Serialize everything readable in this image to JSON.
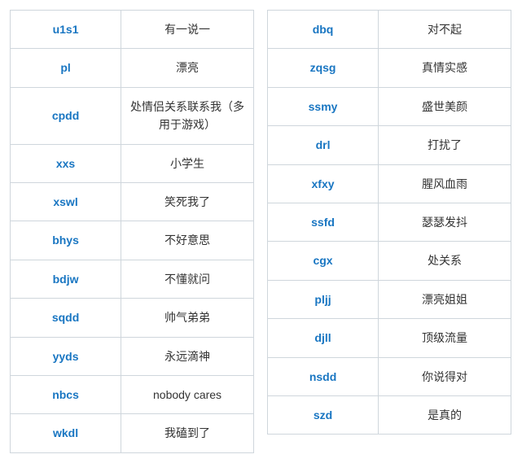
{
  "left": [
    {
      "abbr": "u1s1",
      "meaning": "有一说一"
    },
    {
      "abbr": "pl",
      "meaning": "漂亮"
    },
    {
      "abbr": "cpdd",
      "meaning": "处情侣关系联系我（多用于游戏）"
    },
    {
      "abbr": "xxs",
      "meaning": "小学生"
    },
    {
      "abbr": "xswl",
      "meaning": "笑死我了"
    },
    {
      "abbr": "bhys",
      "meaning": "不好意思"
    },
    {
      "abbr": "bdjw",
      "meaning": "不懂就问"
    },
    {
      "abbr": "sqdd",
      "meaning": "帅气弟弟"
    },
    {
      "abbr": "yyds",
      "meaning": "永远滴神"
    },
    {
      "abbr": "nbcs",
      "meaning": "nobody cares"
    },
    {
      "abbr": "wkdl",
      "meaning": "我磕到了"
    }
  ],
  "right": [
    {
      "abbr": "dbq",
      "meaning": "对不起"
    },
    {
      "abbr": "zqsg",
      "meaning": "真情实感"
    },
    {
      "abbr": "ssmy",
      "meaning": "盛世美颜"
    },
    {
      "abbr": "drl",
      "meaning": "打扰了"
    },
    {
      "abbr": "xfxy",
      "meaning": "腥风血雨"
    },
    {
      "abbr": "ssfd",
      "meaning": "瑟瑟发抖"
    },
    {
      "abbr": "cgx",
      "meaning": "处关系"
    },
    {
      "abbr": "pljj",
      "meaning": "漂亮姐姐"
    },
    {
      "abbr": "djll",
      "meaning": "顶级流量"
    },
    {
      "abbr": "nsdd",
      "meaning": "你说得对"
    },
    {
      "abbr": "szd",
      "meaning": "是真的"
    }
  ]
}
